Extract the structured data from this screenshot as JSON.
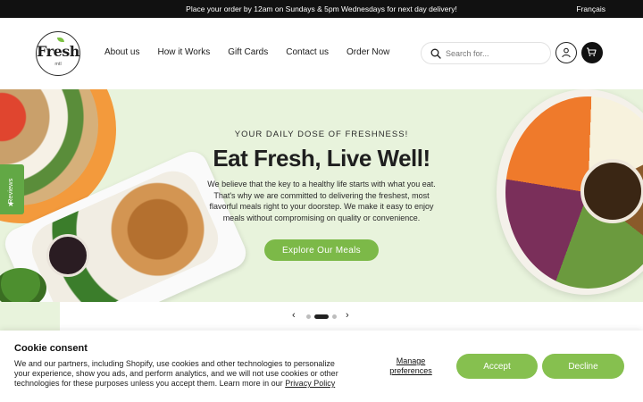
{
  "announcement": {
    "text": "Place your order by 12am on Sundays & 5pm Wednesdays for next day delivery!",
    "language_link": "Français"
  },
  "brand": {
    "logo_word": "Fresh",
    "logo_sub": "mtl"
  },
  "nav": {
    "items": [
      "About us",
      "How it Works",
      "Gift Cards",
      "Contact us",
      "Order Now"
    ]
  },
  "search": {
    "placeholder": "Search for..."
  },
  "icons": {
    "search": "search-icon",
    "account": "user-icon",
    "cart": "cart-icon",
    "reviews_star": "star-icon",
    "prev": "chevron-left-icon",
    "next": "chevron-right-icon"
  },
  "hero": {
    "tagline": "YOUR DAILY DOSE OF FRESHNESS!",
    "title": "Eat Fresh, Live Well!",
    "description": "We believe that the key to a healthy life starts with what you eat. That's why we are committed to delivering the freshest, most flavorful meals right to your doorstep. We make it easy to enjoy meals without compromising on quality or convenience.",
    "cta": "Explore Our Meals"
  },
  "reviews_tab": {
    "label": "Reviews"
  },
  "slider": {
    "total": 3,
    "active_index": 2
  },
  "cookie": {
    "title": "Cookie consent",
    "body_text": "We and our partners, including Shopify, use cookies and other technologies to personalize your experience, show you ads, and perform analytics, and we will not use cookies or other technologies for these purposes unless you accept them. Learn more in our ",
    "policy_link": "Privacy Policy",
    "manage_label": "Manage preferences",
    "accept_label": "Accept",
    "decline_label": "Decline"
  },
  "colors": {
    "announcement_bg": "#111111",
    "hero_bg": "#e8f3dc",
    "accent_green": "#86c04f",
    "cta_green": "#7cb948",
    "reviews_green": "#62a845"
  }
}
